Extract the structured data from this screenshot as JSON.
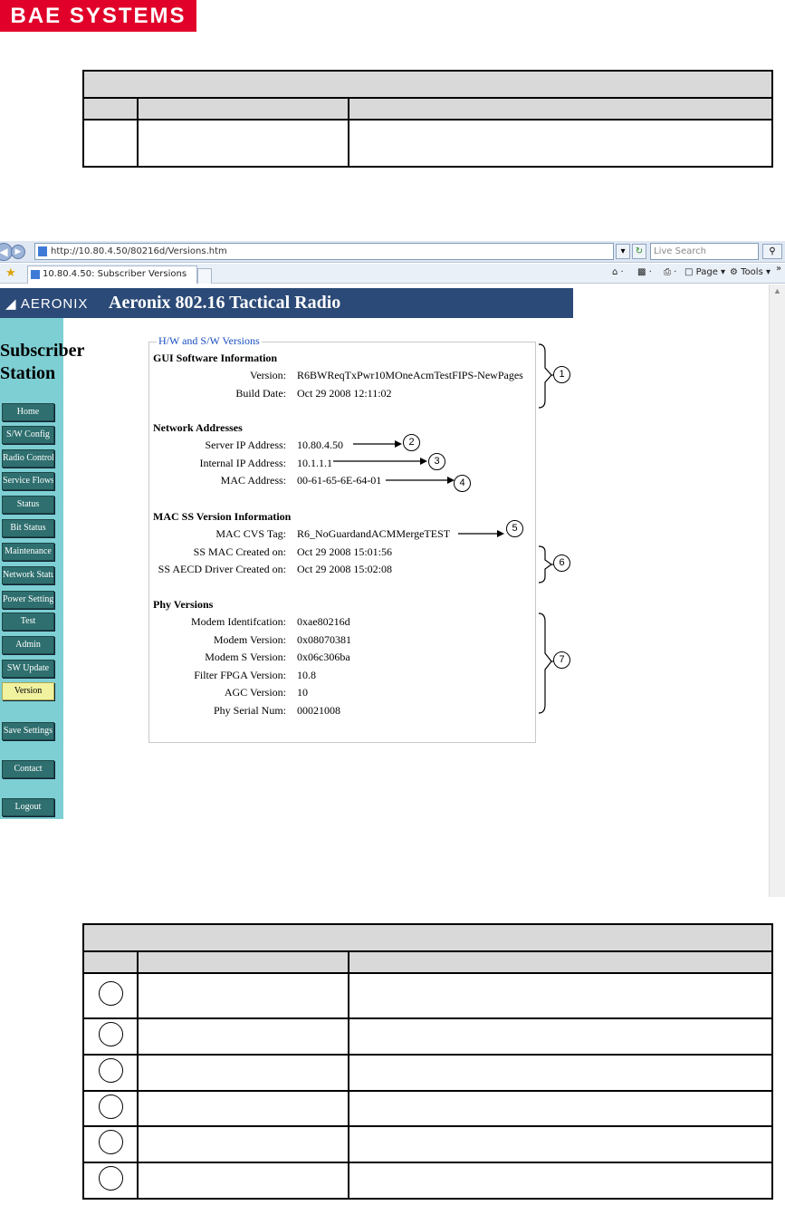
{
  "logo": "BAE SYSTEMS",
  "browser": {
    "url": "http://10.80.4.50/80216d/Versions.htm",
    "search_placeholder": "Live Search",
    "tab_title": "10.80.4.50: Subscriber Versions",
    "page_menu": "Page",
    "tools_menu": "Tools"
  },
  "app": {
    "brand": "AERONIX",
    "title": "Aeronix 802.16 Tactical Radio",
    "station_line1": "Subscriber",
    "station_line2": "Station"
  },
  "sidebar": {
    "items": [
      "Home",
      "S/W Config",
      "Radio Control",
      "Service Flows",
      "Status",
      "Bit Status",
      "Maintenance",
      "Network Status",
      "Power Settings",
      "Test",
      "Admin",
      "SW Update",
      "Version",
      "Save Settings",
      "Contact",
      "Logout"
    ],
    "active": "Version"
  },
  "versions": {
    "legend": "H/W and S/W Versions",
    "gui": {
      "heading": "GUI Software Information",
      "rows": [
        {
          "label": "Version:",
          "value": "R6BWReqTxPwr10MOneAcmTestFIPS-NewPages"
        },
        {
          "label": "Build Date:",
          "value": "Oct 29 2008 12:11:02"
        }
      ]
    },
    "network": {
      "heading": "Network Addresses",
      "rows": [
        {
          "label": "Server IP Address:",
          "value": "10.80.4.50"
        },
        {
          "label": "Internal IP Address:",
          "value": "10.1.1.1"
        },
        {
          "label": "MAC Address:",
          "value": "00-61-65-6E-64-01"
        }
      ]
    },
    "macss": {
      "heading": "MAC SS Version Information",
      "rows": [
        {
          "label": "MAC CVS Tag:",
          "value": "R6_NoGuardandACMMergeTEST"
        },
        {
          "label": "SS MAC Created on:",
          "value": "Oct 29 2008 15:01:56"
        },
        {
          "label": "SS AECD Driver Created on:",
          "value": "Oct 29 2008 15:02:08"
        }
      ]
    },
    "phy": {
      "heading": "Phy Versions",
      "rows": [
        {
          "label": "Modem Identifcation:",
          "value": "0xae80216d"
        },
        {
          "label": "Modem Version:",
          "value": "0x08070381"
        },
        {
          "label": "Modem S Version:",
          "value": "0x06c306ba"
        },
        {
          "label": "Filter FPGA Version:",
          "value": "10.8"
        },
        {
          "label": "AGC Version:",
          "value": "10"
        },
        {
          "label": "Phy Serial Num:",
          "value": "00021008"
        }
      ]
    }
  },
  "callouts": [
    "1",
    "2",
    "3",
    "4",
    "5",
    "6",
    "7"
  ]
}
